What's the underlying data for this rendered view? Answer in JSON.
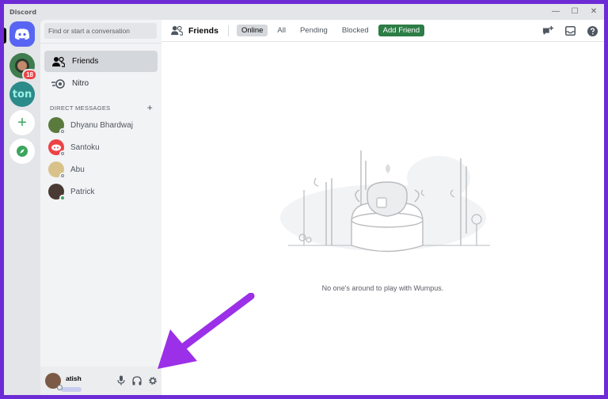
{
  "window": {
    "title": "Discord",
    "controls": [
      "minimize",
      "maximize",
      "close"
    ]
  },
  "servers": [
    {
      "name": "home",
      "icon": "discord-logo-icon"
    },
    {
      "name": "user-server",
      "badge": "18"
    },
    {
      "name": "ton-server",
      "label": "ton"
    },
    {
      "name": "add-server",
      "icon": "plus-icon"
    },
    {
      "name": "explore",
      "icon": "compass-icon"
    }
  ],
  "sidebar": {
    "search_placeholder": "Find or start a conversation",
    "nav": [
      {
        "label": "Friends",
        "icon": "friends-icon",
        "active": true
      },
      {
        "label": "Nitro",
        "icon": "nitro-icon"
      }
    ],
    "dm_header": "DIRECT MESSAGES",
    "dms": [
      {
        "name": "Dhyanu Bhardwaj",
        "status": "offline",
        "color": "#5b7a3e"
      },
      {
        "name": "Santoku",
        "status": "offline",
        "color": "#ed4245"
      },
      {
        "name": "Abu",
        "status": "offline",
        "color": "#d8c28a"
      },
      {
        "name": "Patrick",
        "status": "online",
        "color": "#4a3a34"
      }
    ]
  },
  "user_panel": {
    "username": "atish"
  },
  "topbar": {
    "title": "Friends",
    "tabs": [
      {
        "label": "Online",
        "selected": true
      },
      {
        "label": "All"
      },
      {
        "label": "Pending"
      },
      {
        "label": "Blocked"
      }
    ],
    "add_friend": "Add Friend"
  },
  "main": {
    "empty_message": "No one's around to play with Wumpus."
  },
  "colors": {
    "accent": "#5865f2",
    "add_friend_green": "#2d7d46",
    "online": "#3ba55c",
    "annotation_arrow": "#9b30e8"
  }
}
